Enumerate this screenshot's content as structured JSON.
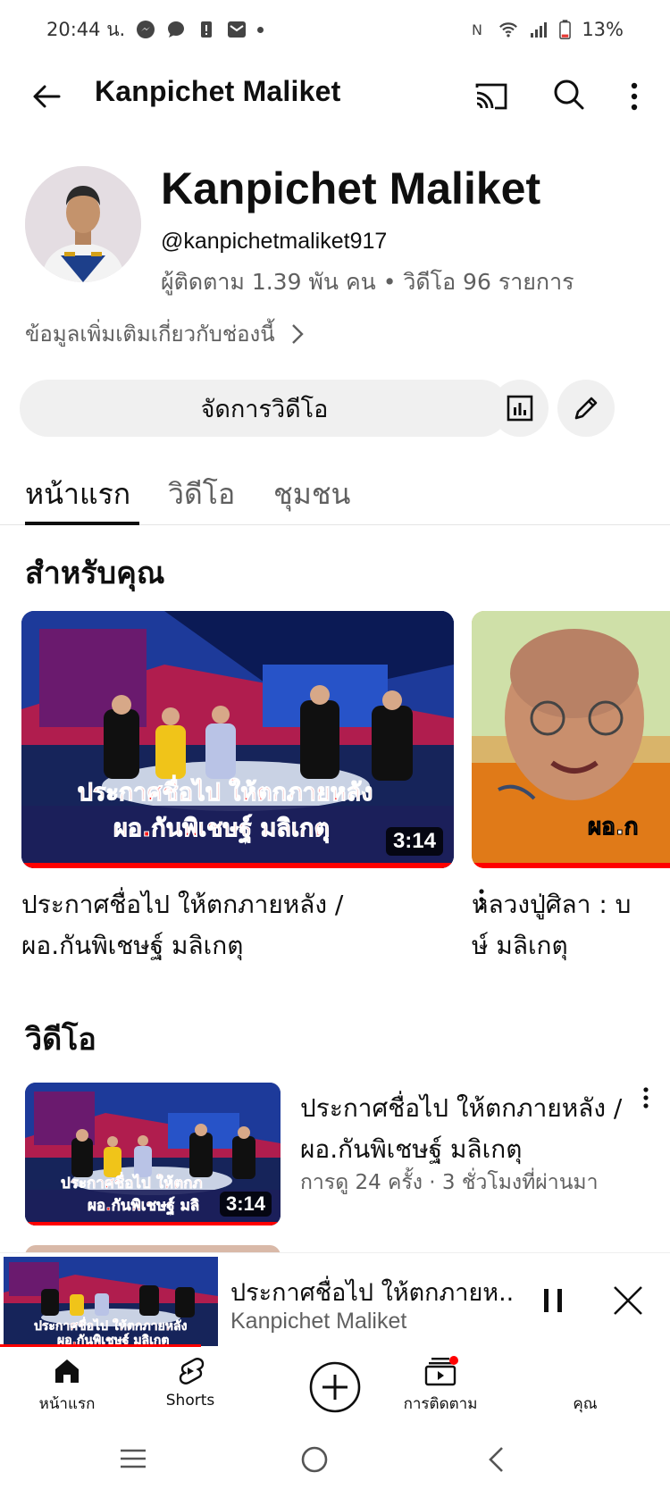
{
  "status_bar": {
    "time": "20:44 น.",
    "battery": "13%"
  },
  "app_bar": {
    "title": "Kanpichet Maliket",
    "icons": [
      "back-arrow-icon",
      "cast-icon",
      "search-icon",
      "more-vert-icon"
    ]
  },
  "channel": {
    "name": "Kanpichet Maliket",
    "handle": "@kanpichetmaliket917",
    "stats": "ผู้ติดตาม 1.39 พัน คน • วิดีโอ 96 รายการ",
    "more_info": "ข้อมูลเพิ่มเติมเกี่ยวกับช่องนี้"
  },
  "actions": {
    "manage_videos": "จัดการวิดีโอ"
  },
  "tabs": [
    {
      "label": "หน้าแรก",
      "active": true
    },
    {
      "label": "วิดีโอ",
      "active": false
    },
    {
      "label": "ชุมชน",
      "active": false
    }
  ],
  "for_you": {
    "heading": "สำหรับคุณ",
    "cards": [
      {
        "title_line1": "ประกาศชื่อไป ให้ตกภายหลัง /",
        "title_line2": "ผอ.กันพิเชษฐ์ มลิเกตุ",
        "duration": "3:14",
        "thumb_caption_line1": "ประกาศชื่อไป ให้ตกภายหลัง",
        "thumb_caption_line2": "ผอ.กันพิเชษฐ์ มลิเกตุ"
      },
      {
        "title_line1": "หลวงปู่ศิลา : บ",
        "title_line2": "ษ์ มลิเกตุ",
        "thumb_caption": "ผอ.ก"
      }
    ]
  },
  "videos": {
    "heading": "วิดีโอ",
    "items": [
      {
        "title": "ประกาศชื่อไป ให้ตกภายหลัง /ผอ.กันพิเชษฐ์ มลิเกตุ",
        "meta": "การดู 24 ครั้ง · 3 ชั่วโมงที่ผ่านมา",
        "duration": "3:14",
        "thumb_caption_line1": "ประกาศชื่อไป ให้ตกภ",
        "thumb_caption_line2": "ผอ.กันพิเชษฐ์ มลิ"
      }
    ]
  },
  "mini_player": {
    "title": "ประกาศชื่อไป ให้ตกภายห..",
    "channel": "Kanpichet Maliket",
    "thumb_caption_line1": "ประกาศชื่อไป ให้ตกภายหลัง",
    "thumb_caption_line2": "ผอ.กันพิเชษฐ์ มลิเกตุ",
    "progress": 0.3
  },
  "bottom_nav": [
    {
      "label": "หน้าแรก",
      "icon": "home-icon"
    },
    {
      "label": "Shorts",
      "icon": "shorts-icon"
    },
    {
      "label": "",
      "icon": "create-icon"
    },
    {
      "label": "การติดตาม",
      "icon": "subscriptions-icon"
    },
    {
      "label": "คุณ",
      "icon": "you-icon"
    }
  ],
  "colors": {
    "accent": "#ff0000",
    "text_primary": "#0f0f0f",
    "text_secondary": "#606060",
    "chip_bg": "#f0f0f0"
  }
}
